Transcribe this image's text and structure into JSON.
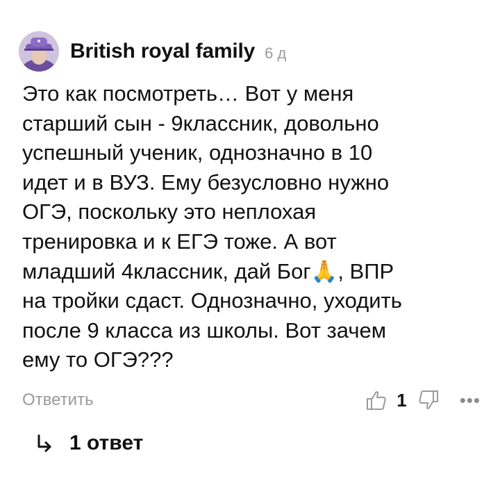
{
  "comment": {
    "author": "British royal family",
    "timestamp": "6 д",
    "text_before_emoji": "Это как посмотреть… Вот у меня\nстарший сын - 9классник, довольно\nуспешный ученик, однозначно в 10\nидет и в ВУЗ. Ему безусловно нужно\nОГЭ, поскольку это неплохая\nтренировка и к ЕГЭ тоже. А вот\nмладший 4классник, дай Бог",
    "emoji": "🙏",
    "text_after_emoji": ", ВПР\nна тройки сдаст. Однозначно, уходить\nпосле 9 класса из школы. Вот зачем\nему то ОГЭ???",
    "reply_label": "Ответить",
    "like_count": "1",
    "more_label": "•••",
    "replies_label": "1 ответ",
    "icons": {
      "avatar": "profile-photo",
      "like": "thumbs-up-icon",
      "dislike": "thumbs-down-icon",
      "more": "more-dots-icon",
      "replies": "reply-arrow-icon"
    },
    "colors": {
      "text": "#111111",
      "muted": "#9a9a9a"
    }
  }
}
